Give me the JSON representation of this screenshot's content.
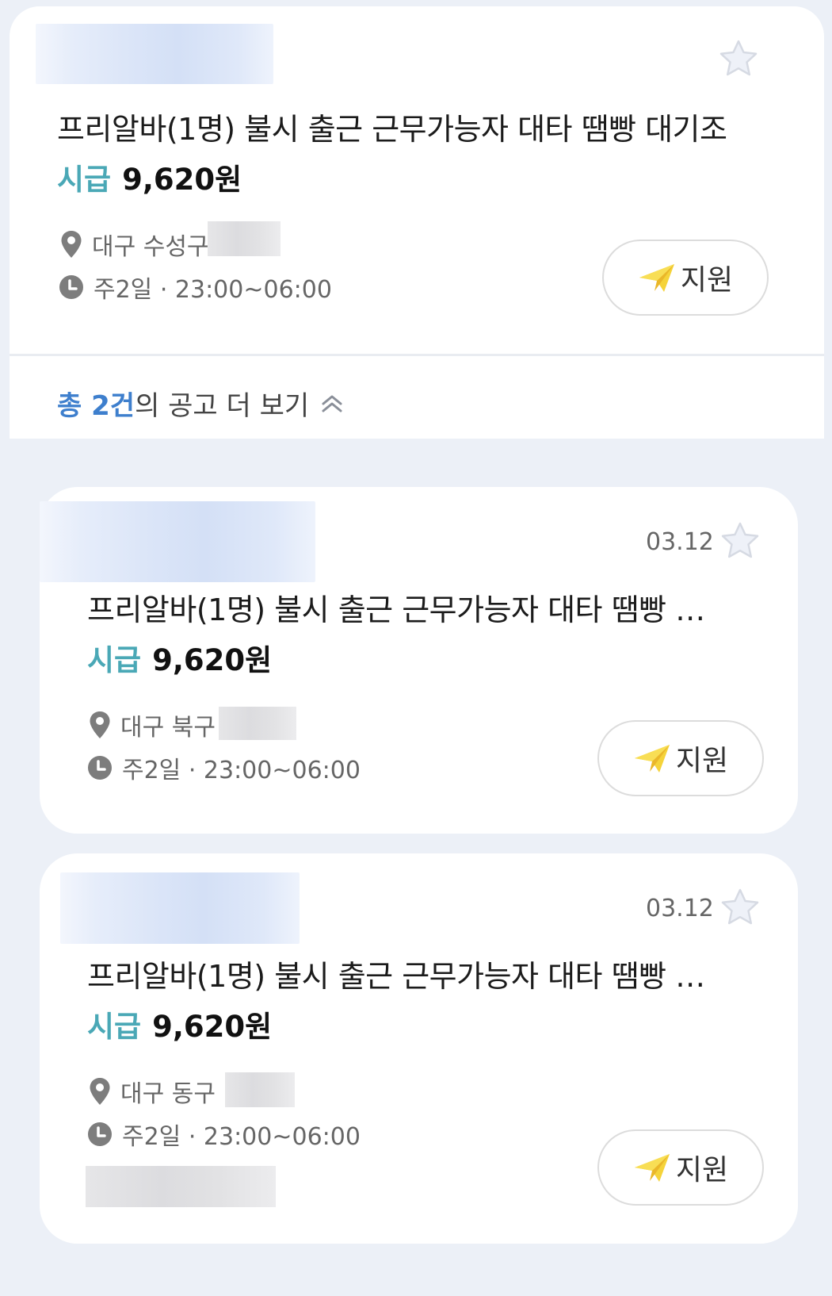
{
  "main_job": {
    "title": "프리알바(1명) 불시 출근 근무가능자 대타 땜빵 대기조",
    "wage_label": "시급",
    "wage_value": "9,620원",
    "location": "대구 수성구",
    "schedule": "주2일 · 23:00~06:00",
    "apply_label": "지원"
  },
  "more_link": {
    "prefix": "총 2건",
    "suffix": "의 공고 더 보기"
  },
  "sub_jobs": [
    {
      "date": "03.12",
      "title": "프리알바(1명) 불시 출근 근무가능자 대타 땜빵 …",
      "wage_label": "시급",
      "wage_value": "9,620원",
      "location": "대구 북구",
      "schedule": "주2일 · 23:00~06:00",
      "apply_label": "지원"
    },
    {
      "date": "03.12",
      "title": "프리알바(1명) 불시 출근 근무가능자 대타 땜빵 …",
      "wage_label": "시급",
      "wage_value": "9,620원",
      "location": "대구 동구",
      "schedule": "주2일 · 23:00~06:00",
      "apply_label": "지원"
    }
  ],
  "colors": {
    "wage_label": "#4aa8b6",
    "more_count": "#3e7fcd",
    "background": "#ecf0f7",
    "send_icon": "#f5d33a"
  },
  "icons": [
    "star-icon",
    "location-pin-icon",
    "clock-icon",
    "send-icon",
    "chevron-up-icon"
  ]
}
